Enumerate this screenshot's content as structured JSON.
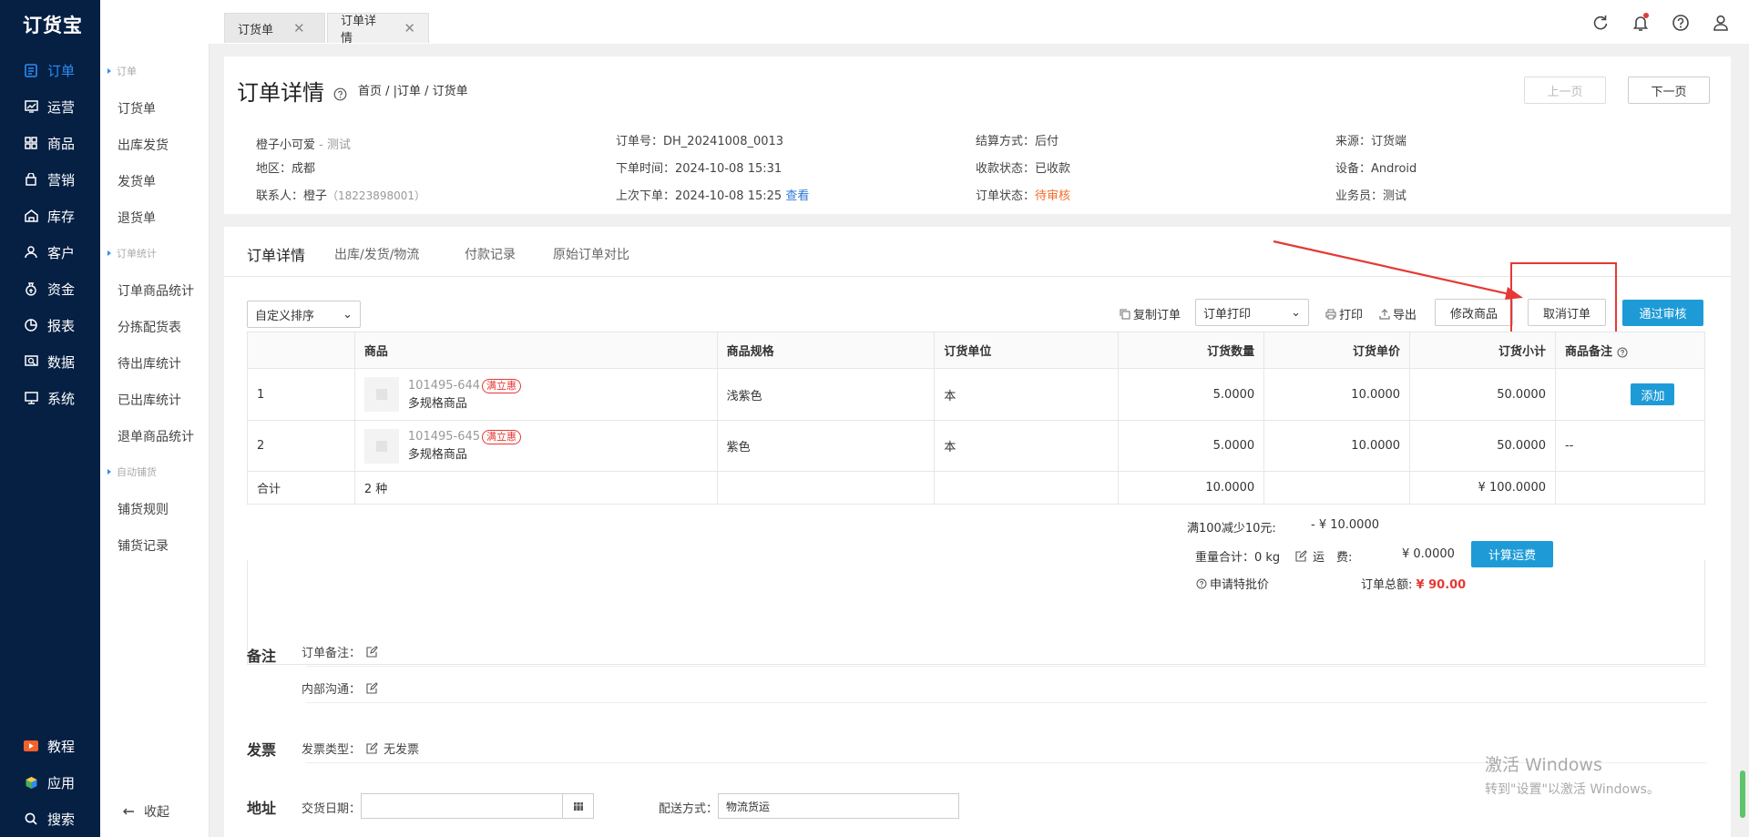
{
  "app": {
    "logo": "订货宝"
  },
  "nav": {
    "items": [
      {
        "label": "订单",
        "icon": "order-icon",
        "active": true
      },
      {
        "label": "运营",
        "icon": "operation-icon"
      },
      {
        "label": "商品",
        "icon": "grid-icon"
      },
      {
        "label": "营销",
        "icon": "marketing-icon"
      },
      {
        "label": "库存",
        "icon": "warehouse-icon"
      },
      {
        "label": "客户",
        "icon": "user-icon"
      },
      {
        "label": "资金",
        "icon": "money-icon"
      },
      {
        "label": "报表",
        "icon": "pie-chart-icon"
      },
      {
        "label": "数据",
        "icon": "data-icon"
      },
      {
        "label": "系统",
        "icon": "monitor-icon"
      }
    ],
    "bottom": [
      {
        "label": "教程",
        "icon": "video-icon"
      },
      {
        "label": "应用",
        "icon": "cube-icon"
      },
      {
        "label": "搜索",
        "icon": "search-icon"
      }
    ]
  },
  "subnav": {
    "groups": [
      "订单",
      "订单统计",
      "自动铺货"
    ],
    "items": [
      "订货单",
      "出库发货",
      "发货单",
      "退货单",
      "订单商品统计",
      "分拣配货表",
      "待出库统计",
      "已出库统计",
      "退单商品统计",
      "铺货规则",
      "铺货记录"
    ],
    "collapse": "收起"
  },
  "tabs": [
    {
      "label": "订货单"
    },
    {
      "label": "订单详情"
    }
  ],
  "page": {
    "title": "订单详情",
    "breadcrumb": "首页 / |订单 / 订货单",
    "prev": "上一页",
    "next": "下一页"
  },
  "info": {
    "customer": "橙子小可爱",
    "customer_tag": " - 测试",
    "region_label": "地区：",
    "region": "成都",
    "contact_label": "联系人：",
    "contact": "橙子",
    "phone": "（18223898001）",
    "order_no_label": "订单号：",
    "order_no": "DH_20241008_0013",
    "order_time_label": "下单时间：",
    "order_time": "2024-10-08 15:31",
    "last_order_label": "上次下单：",
    "last_order": "2024-10-08 15:25",
    "view": "查看",
    "settle_label": "结算方式：",
    "settle": "后付",
    "pay_status_label": "收款状态：",
    "pay_status": "已收款",
    "order_status_label": "订单状态：",
    "order_status": "待审核",
    "source_label": "来源：",
    "source": "订货端",
    "device_label": "设备：",
    "device": "Android",
    "sales_label": "业务员：",
    "sales": "测试"
  },
  "subtabs": [
    "订单详情",
    "出库/发货/物流",
    "付款记录",
    "原始订单对比"
  ],
  "toolbar": {
    "sort": "自定义排序",
    "copy": "复制订单",
    "print_select": "订单打印",
    "print": "打印",
    "export": "导出",
    "edit": "修改商品",
    "cancel": "取消订单",
    "approve": "通过审核"
  },
  "table": {
    "headers": [
      "",
      "商品",
      "商品规格",
      "订货单位",
      "订货数量",
      "订货单价",
      "订货小计",
      "商品备注"
    ],
    "rows": [
      {
        "no": "1",
        "code": "101495-644",
        "badge": "满立惠",
        "name": "多规格商品",
        "spec": "浅紫色",
        "unit": "本",
        "qty": "5.0000",
        "price": "10.0000",
        "subtotal": "50.0000",
        "remark_btn": "添加"
      },
      {
        "no": "2",
        "code": "101495-645",
        "badge": "满立惠",
        "name": "多规格商品",
        "spec": "紫色",
        "unit": "本",
        "qty": "5.0000",
        "price": "10.0000",
        "subtotal": "50.0000",
        "remark": "--"
      }
    ],
    "total": {
      "label": "合计",
      "kinds": "2 种",
      "qty": "10.0000",
      "amount": "¥ 100.0000"
    }
  },
  "summary": {
    "discount_label": "满100减少10元:",
    "discount": "- ¥ 10.0000",
    "weight": "重量合计：0 kg",
    "freight_label": "运　费:",
    "freight": "¥ 0.0000",
    "calc": "计算运费",
    "special": "申请特批价",
    "total_label": "订单总额:",
    "total_prefix": "¥ ",
    "total": "90.00"
  },
  "remarks": {
    "title": "备注",
    "order_remark": "订单备注：",
    "internal": "内部沟通："
  },
  "invoice": {
    "title": "发票",
    "type_label": "发票类型：",
    "type": "无发票"
  },
  "address": {
    "title": "地址",
    "date_label": "交货日期：",
    "ship_label": "配送方式：",
    "ship": "物流货运"
  },
  "watermark": {
    "line1": "激活 Windows",
    "line2": "转到\"设置\"以激活 Windows。"
  },
  "colors": {
    "nav_bg": "#062044",
    "accent": "#2c8df5",
    "primary_btn": "#1e9bd7",
    "danger": "#e53935",
    "warning": "#f56c2a"
  }
}
